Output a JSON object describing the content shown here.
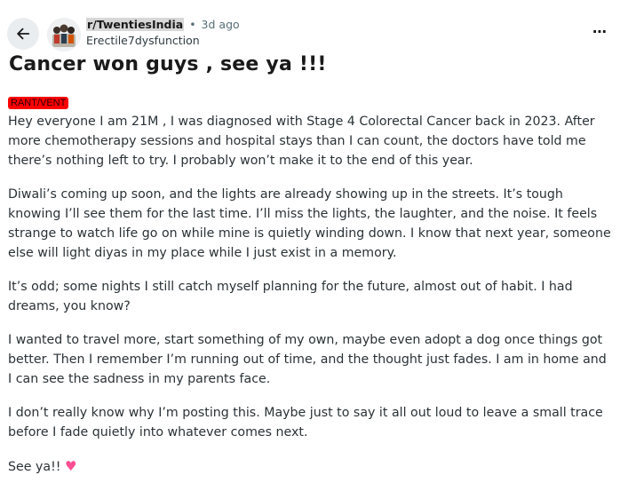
{
  "header": {
    "subreddit": "r/TwentiesIndia",
    "separator": "•",
    "time_ago": "3d ago",
    "username": "Erectile7dysfunction",
    "overflow_label": "⋯"
  },
  "post": {
    "title": "Cancer won guys , see ya !!!",
    "flair": "RANT/VENT",
    "paragraphs": [
      "Hey everyone I am 21M , I was diagnosed with Stage 4 Colorectal Cancer back in 2023. After more chemotherapy sessions and hospital stays than I can count, the doctors have told me there’s nothing left to try. I probably won’t make it to the end of this year.",
      "Diwali’s coming up soon, and the lights are already showing up in the streets. It’s tough knowing I’ll see them for the last time. I’ll miss the lights, the laughter, and the noise. It feels strange to watch life go on while mine is quietly winding down. I know that next year, someone else will light diyas in my place while I just exist in a memory.",
      "It’s odd; some nights I still catch myself planning for the future, almost out of habit. I had dreams, you know?",
      "I wanted to travel more, start something of my own, maybe even adopt a dog once things got better. Then I remember I’m running out of time, and the thought just fades. I am in home and I can see the sadness in my parents face.",
      "I don’t really know why I’m posting this. Maybe just to say it all out loud to leave a small trace before I fade quietly into whatever comes next."
    ],
    "signoff": "See ya!!",
    "signoff_emoji": "♥"
  },
  "icons": {
    "back": "arrow-left-icon",
    "avatar": "subreddit-avatar",
    "overflow": "more-options-icon"
  },
  "colors": {
    "flair_bg": "#ff0000",
    "heart": "#ff4f93",
    "back_button_bg": "#eaedef",
    "meta_text": "#576f76"
  }
}
